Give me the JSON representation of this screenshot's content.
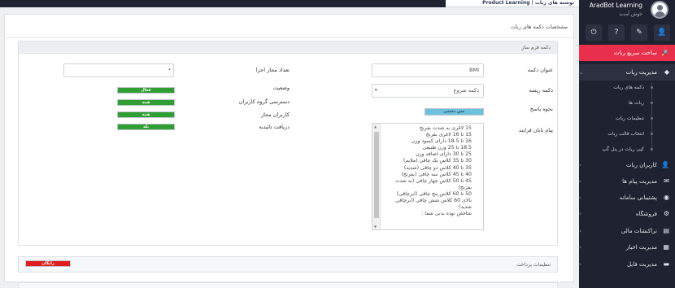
{
  "window": {
    "top_tab": "Product Learning | نوشته های ربات"
  },
  "sidebar": {
    "brand": "AradBot Learning",
    "welcome": "خوش آمدید",
    "quick_actions": [
      {
        "icon": "power-icon",
        "glyph": "⏻"
      },
      {
        "icon": "help-icon",
        "glyph": "?"
      },
      {
        "icon": "user-edit-icon",
        "glyph": "✎"
      },
      {
        "icon": "user-icon",
        "glyph": "👤"
      }
    ],
    "items": [
      {
        "label": "ساخت سریع ربات",
        "icon": "rocket-icon",
        "glyph": "🚀",
        "style": "red"
      },
      {
        "label": "مدیریت ربات",
        "icon": "robot-icon",
        "glyph": "◆",
        "style": "active",
        "chevron": "⌄"
      },
      {
        "label": "کاربران ربات",
        "icon": "users-icon",
        "glyph": "👤",
        "chevron": "‹"
      },
      {
        "label": "مدیریت پیام ها",
        "icon": "mail-icon",
        "glyph": "✉",
        "chevron": "‹"
      },
      {
        "label": "پشتیبانی سامانه",
        "icon": "support-icon",
        "glyph": "◉",
        "chevron": "‹"
      },
      {
        "label": "فروشگاه",
        "icon": "shop-icon",
        "glyph": "⚙",
        "chevron": "‹"
      },
      {
        "label": "تراکنشات مالی",
        "icon": "transactions-icon",
        "glyph": "▤",
        "chevron": "‹"
      },
      {
        "label": "مدیریت اخبار",
        "icon": "news-icon",
        "glyph": "▦",
        "chevron": "‹"
      },
      {
        "label": "مدیریت فایل",
        "icon": "folder-icon",
        "glyph": "▬",
        "chevron": "‹"
      }
    ],
    "subitems": [
      "دکمه های ربات",
      "ربات ها",
      "تنظیمات ربات",
      "انتخاب قالب ربات",
      "کپی ربات در پنل گپ"
    ]
  },
  "main": {
    "page_title": "مشخصات دکمه های ربات",
    "form_box": {
      "title": "دکمه فرم ساز",
      "button_title": {
        "label": "عنوان دکمه",
        "value": "BMI"
      },
      "root_button": {
        "label": "دکمه ریشه",
        "value": "دکمه شروع"
      },
      "reply_method": {
        "label": "نحوه پاسخ",
        "value": "متن دستی"
      },
      "end_message": {
        "label": "پیام پایان فرایند",
        "lines": [
          "15 لاغری به شدت بفرنج",
          "15 تا 16 لاغری بفرنج",
          "16 تا 18.5 دارای کمبود وزن",
          "18.5 تا 25 وزن طبیعی",
          "25 تا 30 دارای اضافه وزن",
          "30 تا 35 کلاس یک چاقی (ملایم)",
          "35 تا 40 کلاس دو چاقی (شدید)",
          "40 تا 45 کلاس سه چاقی (بفرنج)",
          "45 تا 50 کلاس چهار چاقی (به شدت",
          "بفرنج)",
          "50 تا 60 کلاس پنج چاقی (ابرچاقی)",
          "بالای 60 کلاس شش چاقی (ابرچاقی",
          "شدید)",
          "شاخص توده بدنی شما :"
        ]
      },
      "allowed_runs": {
        "label": "تعداد مجاز اجرا",
        "value": ""
      },
      "status": {
        "label": "وضعیت",
        "value": "فعال"
      },
      "group_access": {
        "label": "دسترسی گروه کاربران",
        "value": "همه"
      },
      "allowed_users": {
        "label": "کاربران مجاز",
        "value": "همه"
      },
      "confirm_receive": {
        "label": "دریافت تائیدیه",
        "value": "بله"
      }
    },
    "payment_box": {
      "title": "تنظیمات پرداخت",
      "value": "رایگان"
    }
  },
  "colors": {
    "accent_red": "#e8304c",
    "sidebar_bg": "#1f2230",
    "green": "#2f9e33",
    "blue": "#6cc1dc"
  }
}
